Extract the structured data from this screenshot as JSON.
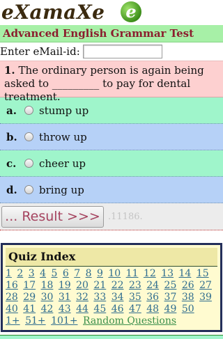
{
  "logo": {
    "text": "eXamaXe",
    "badge_letter": "e"
  },
  "title": "Advanced English Grammar Test",
  "email": {
    "label": "Enter eMail-id:",
    "value": "",
    "placeholder": ""
  },
  "question": {
    "number": "1.",
    "text": "The ordinary person is again being asked to _________ to pay for dental treatment."
  },
  "options": [
    {
      "letter": "a.",
      "text": "stump up"
    },
    {
      "letter": "b.",
      "text": "throw up"
    },
    {
      "letter": "c.",
      "text": "cheer up"
    },
    {
      "letter": "d.",
      "text": "bring up"
    }
  ],
  "result": {
    "button_label": "... Result >>>",
    "counter": ".11186."
  },
  "quiz_index": {
    "title": "Quiz Index",
    "numbers": [
      "1",
      "2",
      "3",
      "4",
      "5",
      "6",
      "7",
      "8",
      "9",
      "10",
      "11",
      "12",
      "13",
      "14",
      "15",
      "16",
      "17",
      "18",
      "19",
      "20",
      "21",
      "22",
      "23",
      "24",
      "25",
      "26",
      "27",
      "28",
      "29",
      "30",
      "31",
      "32",
      "33",
      "34",
      "35",
      "36",
      "37",
      "38",
      "39",
      "40",
      "41",
      "42",
      "43",
      "44",
      "45",
      "46",
      "47",
      "48",
      "49",
      "50"
    ],
    "ranges": [
      "1+",
      "51+",
      "101+"
    ],
    "random_label": "Random Questions"
  },
  "colors": {
    "title_bg": "#a7f0a7",
    "title_text": "#8b1e2e",
    "question_bg": "#fdd0d0",
    "option_green": "#9ff5cb",
    "option_blue": "#b6d1f7",
    "quiz_box_bg": "#fffbd0",
    "quiz_border": "#232e5a",
    "link": "#2f6d8f"
  }
}
